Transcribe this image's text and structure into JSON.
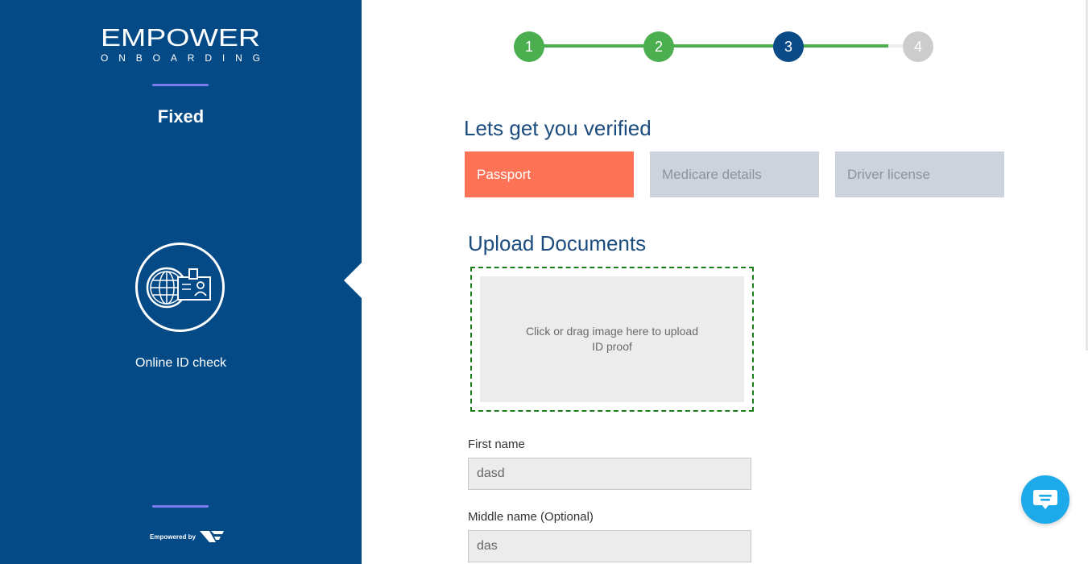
{
  "brand": {
    "name": "EMPOWER",
    "subtitle": "ONBOARDING",
    "powered_by": "Empowered by"
  },
  "sidebar": {
    "plan": "Fixed",
    "current_step_label": "Online ID check",
    "current_step_icon": "online-id-check-icon"
  },
  "progress": {
    "steps": [
      {
        "number": "1",
        "state": "completed",
        "color": "#4bae4f"
      },
      {
        "number": "2",
        "state": "completed",
        "color": "#4bae4f"
      },
      {
        "number": "3",
        "state": "current",
        "color": "#0a4a86"
      },
      {
        "number": "4",
        "state": "pending",
        "color": "#cccccc"
      }
    ]
  },
  "main": {
    "title": "Lets get you verified",
    "tabs": [
      {
        "label": "Passport",
        "active": true
      },
      {
        "label": "Medicare details",
        "active": false
      },
      {
        "label": "Driver license",
        "active": false
      }
    ],
    "upload_title": "Upload Documents",
    "upload_hint_line1": "Click or drag image here to upload",
    "upload_hint_line2": "ID proof",
    "fields": [
      {
        "label": "First name",
        "value": "dasd"
      },
      {
        "label": "Middle name (Optional)",
        "value": "das"
      }
    ]
  },
  "colors": {
    "sidebar_bg": "#044a86",
    "accent_active": "#fe7256",
    "progress_done": "#4bae4f",
    "chat": "#1caaeb"
  },
  "chat": {
    "icon": "chat-icon"
  }
}
